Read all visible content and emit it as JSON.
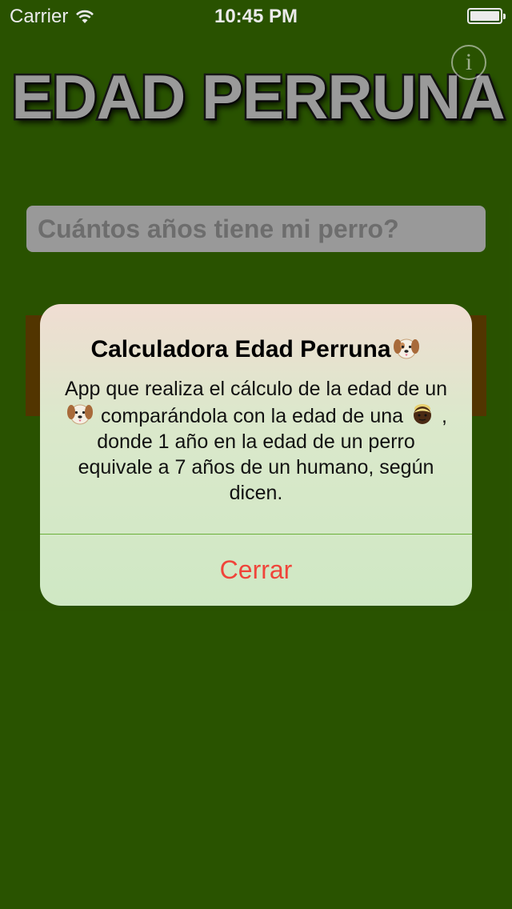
{
  "status_bar": {
    "carrier": "Carrier",
    "time": "10:45 PM"
  },
  "header": {
    "logo_text": "EDAD PERRUNA",
    "info_icon": "i"
  },
  "main": {
    "question_text": "Cuántos años tiene mi perro?"
  },
  "alert": {
    "title": "Calculadora Edad Perruna",
    "title_icon": "dog-face-icon",
    "message_part1": "App que realiza el cálculo de la edad de un",
    "message_part2": "comparándola con la edad de una",
    "message_part3": ", donde 1 año en la edad de un perro equivale a 7 años de un humano, según dicen.",
    "button_label": "Cerrar"
  },
  "colors": {
    "background": "#2d5a00",
    "brown_panel": "#5a3a00",
    "field": "#a6a6a6",
    "alert_button": "#f0443a"
  }
}
